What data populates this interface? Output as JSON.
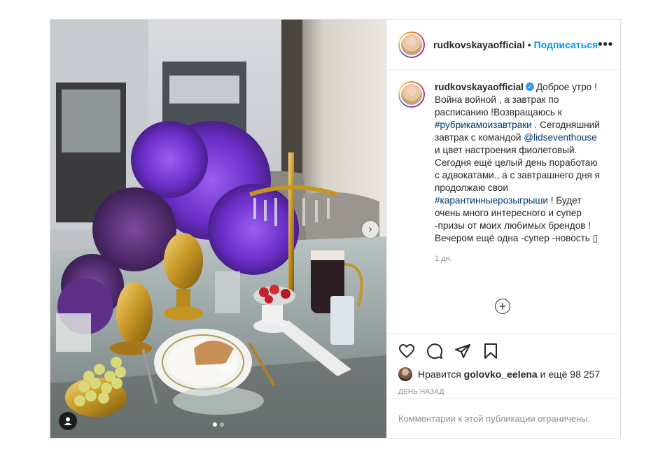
{
  "post": {
    "username": "rudkovskayaofficial",
    "separator": "•",
    "follow_label": "Подписаться",
    "more_label": "•••",
    "caption": {
      "username": "rudkovskayaofficial",
      "part1": "Доброе утро ! Война войной , а завтрак по расписанию !Возвращаюсь к ",
      "hashtag1": "#рубрикамоизавтраки",
      "part2": " . Сегодняшний завтрак с командой ",
      "mention": "@lidseventhouse",
      "part3": " и цвет настроения фиолетовый. Сегодня ещё целый день поработаю с адвокатами., а с завтрашнего дня я продолжаю свои ",
      "hashtag2": "#карантинныерозыгрыши",
      "part4": " ! Будет очень много интересного и супер -призы от моих любимых брендов ! Вечером ещё одна -супер -новость",
      "emoji": "▯"
    },
    "caption_time": "1 дн.",
    "load_more_label": "+",
    "likes": {
      "prefix": "Нравится",
      "liker": "golovko_eelena",
      "suffix": "и ещё 98 257"
    },
    "date_label": "ДЕНЬ НАЗАД",
    "comments_disabled": "Комментарии к этой публикации ограничены.",
    "next_arrow": "›",
    "carousel_count": 2,
    "carousel_active": 1
  },
  "icons": {
    "like": "heart-icon",
    "comment": "comment-icon",
    "share": "paper-plane-icon",
    "save": "bookmark-icon",
    "tag": "user-tag-icon",
    "verified": "verified-badge-icon"
  },
  "colors": {
    "link_blue": "#0095f6",
    "hashtag": "#00376b",
    "verified": "#3897f0",
    "muted": "#8e8e8e",
    "border": "#dbdbdb"
  }
}
